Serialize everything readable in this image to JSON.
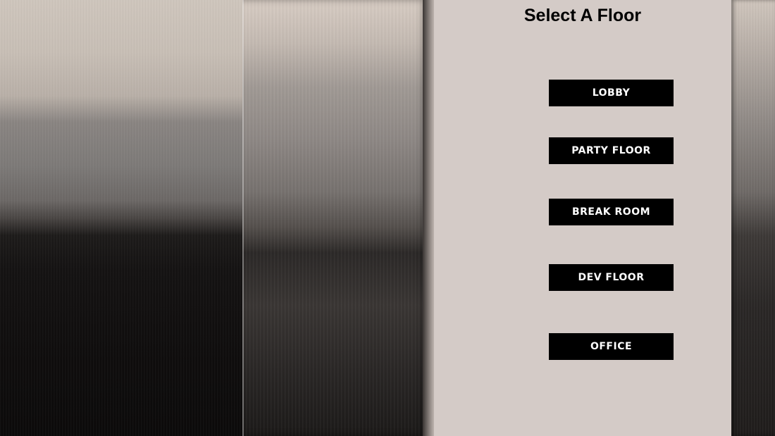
{
  "panel": {
    "title": "Select A Floor",
    "floors": [
      {
        "label": "LOBBY"
      },
      {
        "label": "PARTY FLOOR"
      },
      {
        "label": "BREAK ROOM"
      },
      {
        "label": "DEV FLOOR"
      },
      {
        "label": "OFFICE"
      }
    ]
  },
  "colors": {
    "panel_background": "#d4cbc7",
    "button_background": "#000000",
    "button_text": "#ffffff",
    "title_text": "#000000"
  }
}
